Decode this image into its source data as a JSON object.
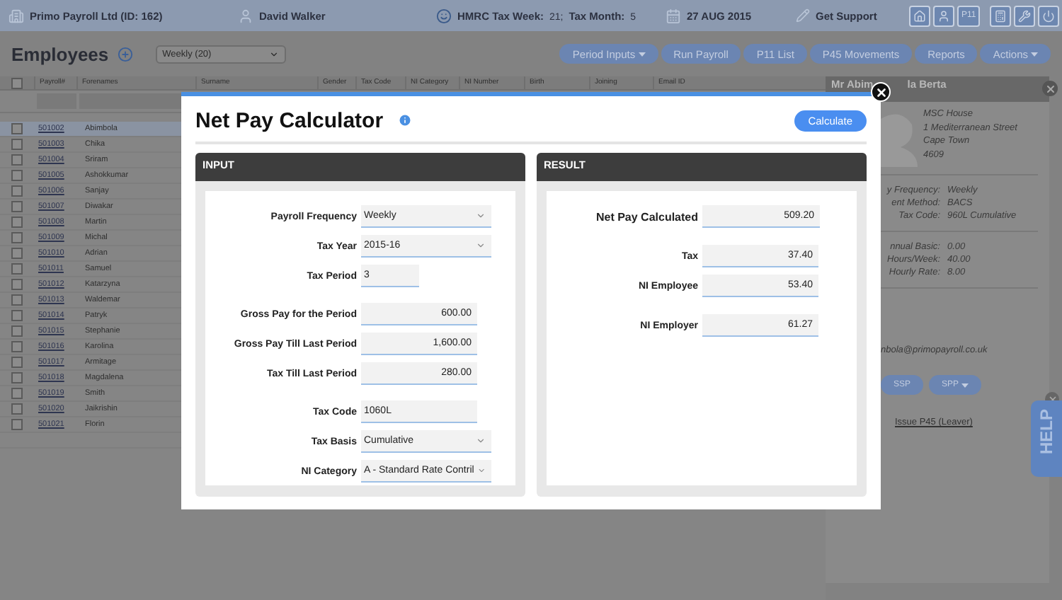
{
  "top_bar": {
    "company": "Primo Payroll Ltd (ID: 162)",
    "user": "David Walker",
    "tax_week_label": "HMRC Tax Week:",
    "tax_week": "21;",
    "tax_month_label": "Tax Month:",
    "tax_month": "5",
    "date": "27 AUG 2015",
    "support": "Get Support",
    "icon_buttons": [
      {
        "kind": "home"
      },
      {
        "kind": "user"
      },
      {
        "kind": "text",
        "label": "P11"
      },
      {
        "kind": "calculator"
      },
      {
        "kind": "tools"
      },
      {
        "kind": "power"
      }
    ]
  },
  "page": {
    "title": "Employees",
    "pay_group": "Weekly (20)",
    "actions": [
      {
        "label": "Period Inputs",
        "dropdown": true
      },
      {
        "label": "Run Payroll",
        "dropdown": false
      },
      {
        "label": "P11 List",
        "dropdown": false
      },
      {
        "label": "P45 Movements",
        "dropdown": false
      },
      {
        "label": "Reports",
        "dropdown": false
      },
      {
        "label": "Actions",
        "dropdown": true
      }
    ]
  },
  "table": {
    "all_checked": false,
    "columns": [
      "Payroll#",
      "Forenames",
      "Surname",
      "Gender",
      "Tax Code",
      "NI Category",
      "NI Number",
      "Birth",
      "Joining",
      "Email ID"
    ],
    "rows": [
      {
        "payroll": "501002",
        "forename": "Abimbola",
        "selected": true
      },
      {
        "payroll": "501003",
        "forename": "Chika",
        "selected": false
      },
      {
        "payroll": "501004",
        "forename": "Sriram",
        "selected": false
      },
      {
        "payroll": "501005",
        "forename": "Ashokkumar",
        "selected": false
      },
      {
        "payroll": "501006",
        "forename": "Sanjay",
        "selected": false
      },
      {
        "payroll": "501007",
        "forename": "Diwakar",
        "selected": false
      },
      {
        "payroll": "501008",
        "forename": "Martin",
        "selected": false
      },
      {
        "payroll": "501009",
        "forename": "Michal",
        "selected": false
      },
      {
        "payroll": "501010",
        "forename": "Adrian",
        "selected": false
      },
      {
        "payroll": "501011",
        "forename": "Samuel",
        "selected": false
      },
      {
        "payroll": "501012",
        "forename": "Katarzyna",
        "selected": false
      },
      {
        "payroll": "501013",
        "forename": "Waldemar",
        "selected": false
      },
      {
        "payroll": "501014",
        "forename": "Patryk",
        "selected": false
      },
      {
        "payroll": "501015",
        "forename": "Stephanie",
        "selected": false
      },
      {
        "payroll": "501016",
        "forename": "Karolina",
        "selected": false
      },
      {
        "payroll": "501017",
        "forename": "Armitage",
        "selected": false
      },
      {
        "payroll": "501018",
        "forename": "Magdalena",
        "selected": false
      },
      {
        "payroll": "501019",
        "forename": "Smith",
        "selected": false
      },
      {
        "payroll": "501020",
        "forename": "Jaikrishin",
        "selected": false
      },
      {
        "payroll": "501021",
        "forename": "Florin",
        "selected": false
      }
    ]
  },
  "employee_card": {
    "title_parts": [
      "Mr Abim",
      "la Berta"
    ],
    "address": [
      "MSC House",
      "1 Mediterranean Street",
      "Cape Town",
      "4609"
    ],
    "details": [
      {
        "label": "y Frequency:",
        "value": "Weekly"
      },
      {
        "label": "ent Method:",
        "value": "BACS"
      },
      {
        "label": "Tax Code:",
        "value": "960L Cumulative"
      }
    ],
    "pay": [
      {
        "label": "nnual Basic:",
        "value": "0.00"
      },
      {
        "label": "Hours/Week:",
        "value": "40.00"
      },
      {
        "label": "Hourly Rate:",
        "value": "8.00"
      }
    ],
    "email": "nbola@primopayroll.co.uk",
    "buttons": [
      {
        "label": "SSP",
        "dropdown": false
      },
      {
        "label": "SPP",
        "dropdown": true
      }
    ],
    "link": "Issue P45 (Leaver)"
  },
  "help": {
    "label": "HELP"
  },
  "modal": {
    "title": "Net Pay Calculator",
    "calculate": "Calculate",
    "input": {
      "heading": "INPUT",
      "groups": [
        [
          {
            "label": "Payroll Frequency",
            "value": "Weekly",
            "kind": "select"
          },
          {
            "label": "Tax Year",
            "value": "2015-16",
            "kind": "select"
          },
          {
            "label": "Tax Period",
            "value": "3",
            "kind": "short"
          }
        ],
        [
          {
            "label": "Gross Pay for the Period",
            "value": "600.00",
            "kind": "amount"
          },
          {
            "label": "Gross Pay Till Last Period",
            "value": "1,600.00",
            "kind": "amount"
          },
          {
            "label": "Tax Till Last Period",
            "value": "280.00",
            "kind": "amount"
          }
        ],
        [
          {
            "label": "Tax Code",
            "value": "1060L",
            "kind": "code"
          },
          {
            "label": "Tax Basis",
            "value": "Cumulative",
            "kind": "select"
          },
          {
            "label": "NI Category",
            "value": "A - Standard Rate Contril",
            "kind": "select"
          }
        ]
      ]
    },
    "result": {
      "heading": "RESULT",
      "groups": [
        [
          {
            "label": "Net Pay Calculated",
            "value": "509.20",
            "kind": "total"
          }
        ],
        [
          {
            "label": "Tax",
            "value": "37.40",
            "kind": "amount"
          },
          {
            "label": "NI Employee",
            "value": "53.40",
            "kind": "amount"
          }
        ],
        [
          {
            "label": "NI Employer",
            "value": "61.27",
            "kind": "amount"
          }
        ]
      ]
    }
  }
}
